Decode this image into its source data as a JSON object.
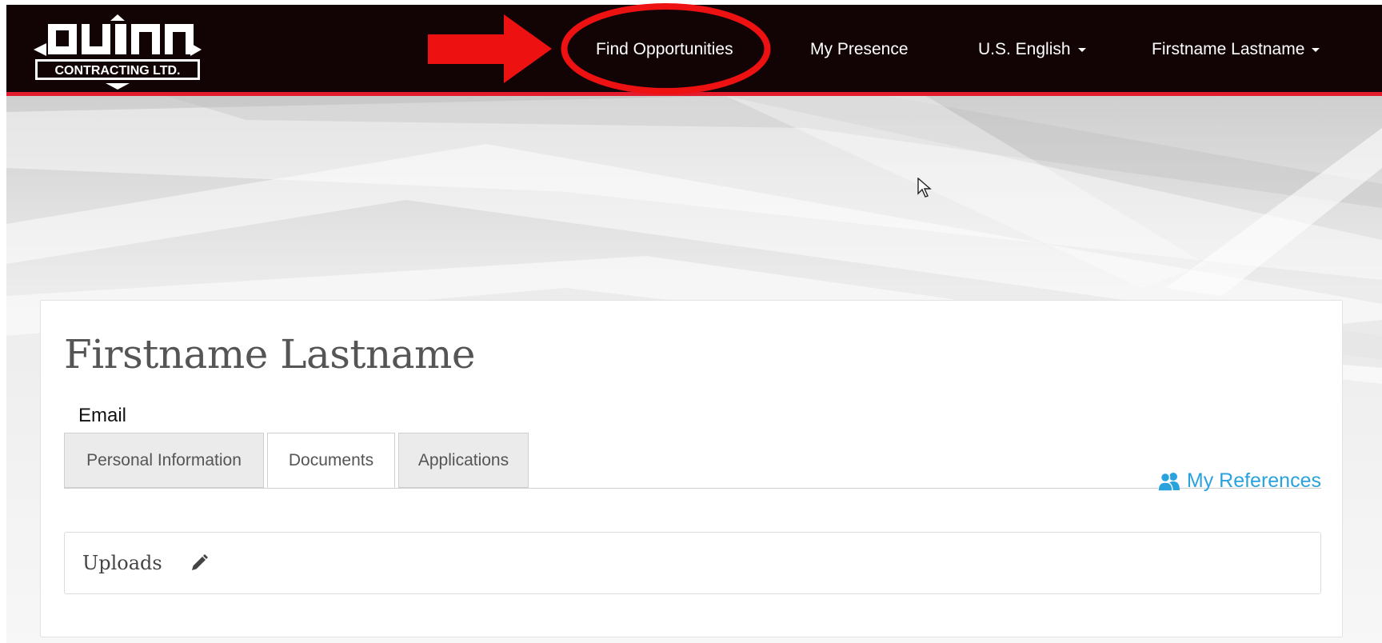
{
  "brand": {
    "logo_word": "QUINN",
    "logo_sub": "CONTRACTING LTD."
  },
  "nav": {
    "find_opportunities": "Find Opportunities",
    "my_presence": "My Presence",
    "language": "U.S. English",
    "user": "Firstname Lastname"
  },
  "profile": {
    "name": "Firstname Lastname",
    "email_label": "Email"
  },
  "tabs": [
    {
      "label": "Personal Information",
      "active": false
    },
    {
      "label": "Documents",
      "active": true
    },
    {
      "label": "Applications",
      "active": false
    }
  ],
  "references": {
    "label": "My References",
    "icon": "users-icon"
  },
  "uploads": {
    "label": "Uploads",
    "icon": "pencil-icon"
  },
  "colors": {
    "navbar": "#120405",
    "accent_red": "#e21b2d",
    "link_blue": "#2aa2de",
    "annotation_red": "#ee1111"
  }
}
